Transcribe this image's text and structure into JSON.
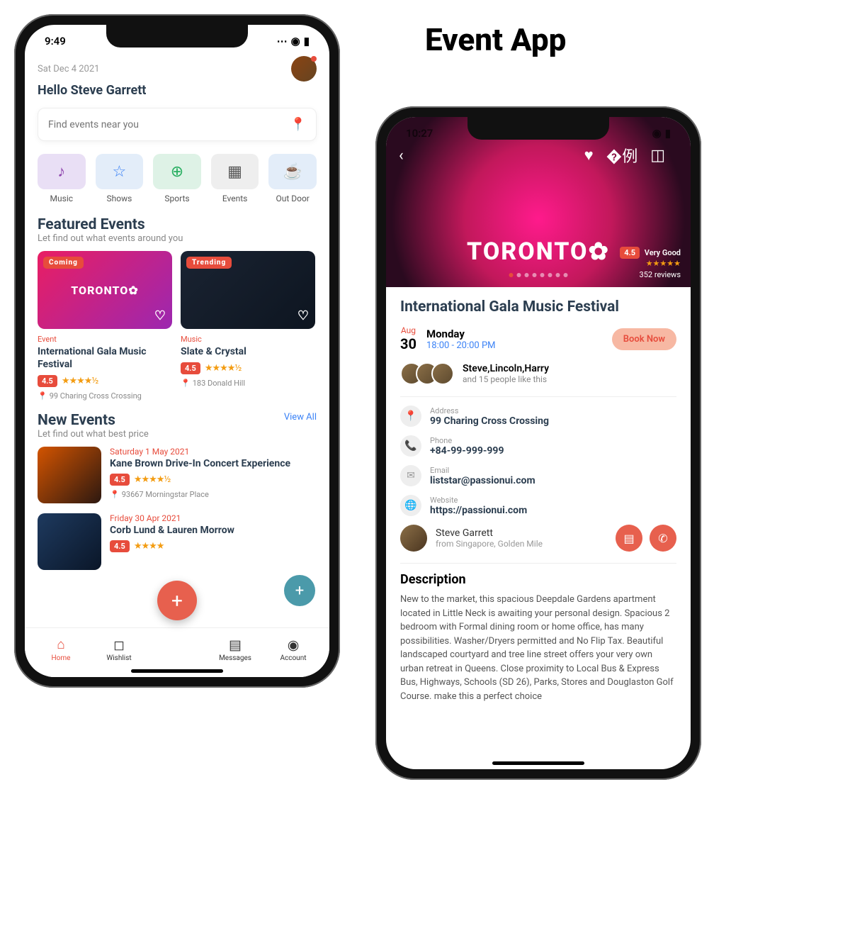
{
  "app_title": "Event App",
  "s1": {
    "time": "9:49",
    "date": "Sat Dec 4 2021",
    "greeting": "Hello Steve Garrett",
    "search_placeholder": "Find events near you",
    "categories": [
      {
        "label": "Music",
        "bg": "#e9dff5",
        "icon": "♪",
        "ic": "#8e44ad"
      },
      {
        "label": "Shows",
        "bg": "#e3edf9",
        "icon": "☆",
        "ic": "#3b82f6"
      },
      {
        "label": "Sports",
        "bg": "#def2e6",
        "icon": "⊕",
        "ic": "#27ae60"
      },
      {
        "label": "Events",
        "bg": "#eeeeee",
        "icon": "▦",
        "ic": "#555"
      },
      {
        "label": "Out Door",
        "bg": "#e3edf9",
        "icon": "☕",
        "ic": "#2980b9"
      }
    ],
    "featured": {
      "title": "Featured Events",
      "subtitle": "Let find out what events around you",
      "cards": [
        {
          "tag": "Coming",
          "img_text": "TORONTO✿",
          "category": "Event",
          "title": "International Gala Music Festival",
          "rating": "4.5",
          "stars": "★★★★½",
          "loc": "99 Charing Cross Crossing"
        },
        {
          "tag": "Trending",
          "img_text": "",
          "category": "Music",
          "title": "Slate & Crystal",
          "rating": "4.5",
          "stars": "★★★★½",
          "loc": "183 Donald Hill"
        }
      ]
    },
    "newev": {
      "title": "New Events",
      "subtitle": "Let find out what best price",
      "view_all": "View All",
      "items": [
        {
          "date": "Saturday 1 May 2021",
          "title": "Kane Brown Drive-In Concert Experience",
          "rating": "4.5",
          "stars": "★★★★½",
          "loc": "93667 Morningstar Place"
        },
        {
          "date": "Friday 30 Apr 2021",
          "title": "Corb Lund & Lauren Morrow",
          "rating": "4.5",
          "stars": "★★★★"
        }
      ]
    },
    "tabs": [
      {
        "label": "Home",
        "icon": "⌂",
        "active": true
      },
      {
        "label": "Wishlist",
        "icon": "◻",
        "active": false
      },
      {
        "label": "Messages",
        "icon": "▤",
        "active": false
      },
      {
        "label": "Account",
        "icon": "◉",
        "active": false
      }
    ]
  },
  "s2": {
    "time": "10:27",
    "hero_text": "TORONTO✿",
    "rating": {
      "score": "4.5",
      "label": "Very Good",
      "stars": "★★★★★",
      "reviews": "352 reviews"
    },
    "title": "International Gala Music Festival",
    "date": {
      "mon": "Aug",
      "day": "30",
      "weekday": "Monday",
      "time": "18:00 - 20:00 PM"
    },
    "book": "Book Now",
    "likes": {
      "names": "Steve,Lincoln,Harry",
      "more": "and 15 people like this"
    },
    "info": [
      {
        "label": "Address",
        "value": "99 Charing Cross Crossing",
        "icon": "📍"
      },
      {
        "label": "Phone",
        "value": "+84-99-999-999",
        "icon": "📞"
      },
      {
        "label": "Email",
        "value": "liststar@passionui.com",
        "icon": "✉"
      },
      {
        "label": "Website",
        "value": "https://passionui.com",
        "icon": "🌐"
      }
    ],
    "organizer": {
      "name": "Steve Garrett",
      "from": "from Singapore, Golden Mile"
    },
    "desc": {
      "heading": "Description",
      "text": "New to the market, this spacious Deepdale Gardens apartment located in Little Neck is awaiting your personal design. Spacious 2 bedroom with Formal dining room or home office, has many possibilities. Washer/Dryers permitted and No Flip Tax. Beautiful landscaped courtyard and tree line street offers your very own urban retreat in Queens. Close proximity to Local Bus & Express Bus, Highways, Schools (SD 26), Parks, Stores and Douglaston Golf Course. make this a perfect choice"
    }
  }
}
